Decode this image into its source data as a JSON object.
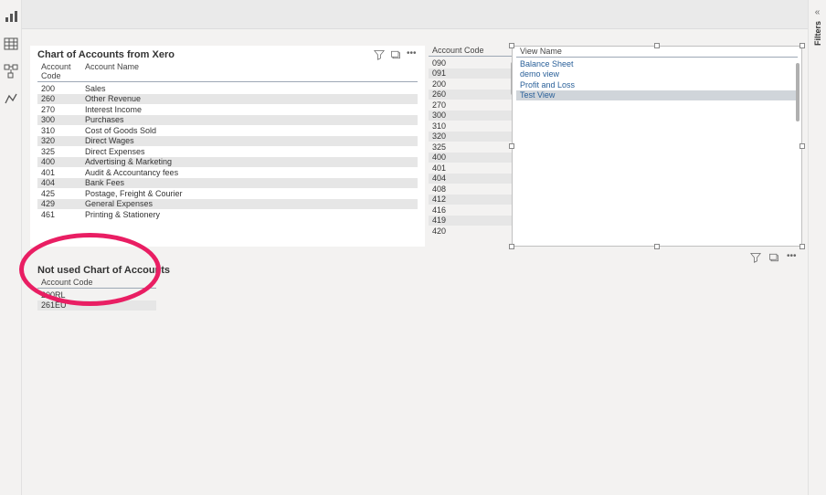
{
  "filtersLabel": "Filters",
  "leftRail": {
    "icons": [
      "report-icon",
      "table-icon",
      "model-icon",
      "dax-icon"
    ]
  },
  "coa": {
    "title": "Chart of Accounts from Xero",
    "headers": {
      "code": "Account Code",
      "name": "Account Name"
    },
    "rows": [
      {
        "code": "200",
        "name": "Sales"
      },
      {
        "code": "260",
        "name": "Other Revenue"
      },
      {
        "code": "270",
        "name": "Interest Income"
      },
      {
        "code": "300",
        "name": "Purchases"
      },
      {
        "code": "310",
        "name": "Cost of Goods Sold"
      },
      {
        "code": "320",
        "name": "Direct Wages"
      },
      {
        "code": "325",
        "name": "Direct Expenses"
      },
      {
        "code": "400",
        "name": "Advertising & Marketing"
      },
      {
        "code": "401",
        "name": "Audit & Accountancy fees"
      },
      {
        "code": "404",
        "name": "Bank Fees"
      },
      {
        "code": "425",
        "name": "Postage, Freight & Courier"
      },
      {
        "code": "429",
        "name": "General Expenses"
      },
      {
        "code": "461",
        "name": "Printing & Stationery"
      }
    ]
  },
  "codes": {
    "header": "Account Code",
    "rows": [
      "090",
      "091",
      "200",
      "260",
      "270",
      "300",
      "310",
      "320",
      "325",
      "400",
      "401",
      "404",
      "408",
      "412",
      "416",
      "419",
      "420"
    ]
  },
  "views": {
    "header": "View Name",
    "rows": [
      "Balance Sheet",
      "demo view",
      "Profit and Loss",
      "Test View"
    ]
  },
  "notused": {
    "title": "Not used Chart of Accounts",
    "header": "Account Code",
    "rows": [
      "200RL",
      "261EU"
    ]
  }
}
